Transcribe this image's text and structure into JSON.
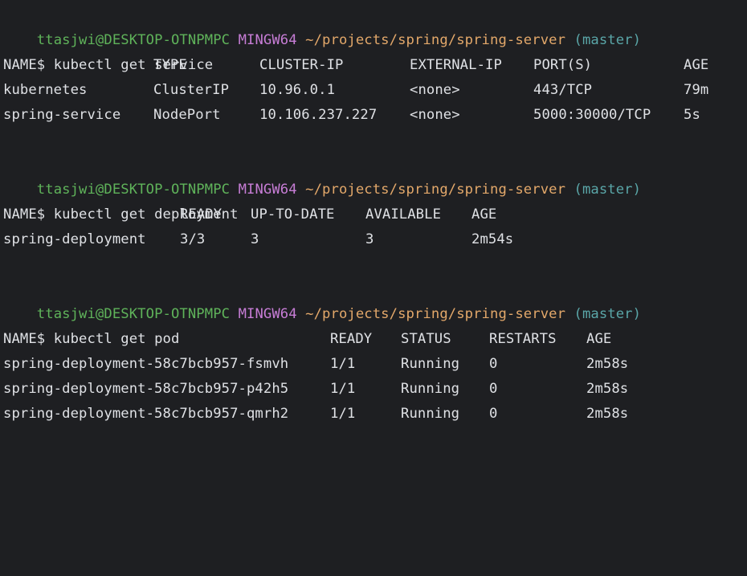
{
  "prompt": {
    "user_host": "ttasjwi@DESKTOP-OTNPMPC",
    "system": "MINGW64",
    "path": "~/projects/spring/spring-server",
    "branch": "(master)",
    "symbol": "$"
  },
  "blocks": [
    {
      "command": "kubectl get service",
      "headers": [
        "NAME",
        "TYPE",
        "CLUSTER-IP",
        "EXTERNAL-IP",
        "PORT(S)",
        "AGE"
      ],
      "rows": [
        [
          "kubernetes",
          "ClusterIP",
          "10.96.0.1",
          "<none>",
          "443/TCP",
          "79m"
        ],
        [
          "spring-service",
          "NodePort",
          "10.106.237.227",
          "<none>",
          "5000:30000/TCP",
          "5s"
        ]
      ]
    },
    {
      "command": "kubectl get deployment",
      "headers": [
        "NAME",
        "READY",
        "UP-TO-DATE",
        "AVAILABLE",
        "AGE"
      ],
      "rows": [
        [
          "spring-deployment",
          "3/3",
          "3",
          "3",
          "2m54s"
        ]
      ]
    },
    {
      "command": "kubectl get pod",
      "headers": [
        "NAME",
        "READY",
        "STATUS",
        "RESTARTS",
        "AGE"
      ],
      "rows": [
        [
          "spring-deployment-58c7bcb957-fsmvh",
          "1/1",
          "Running",
          "0",
          "2m58s"
        ],
        [
          "spring-deployment-58c7bcb957-p42h5",
          "1/1",
          "Running",
          "0",
          "2m58s"
        ],
        [
          "spring-deployment-58c7bcb957-qmrh2",
          "1/1",
          "Running",
          "0",
          "2m58s"
        ]
      ]
    }
  ]
}
